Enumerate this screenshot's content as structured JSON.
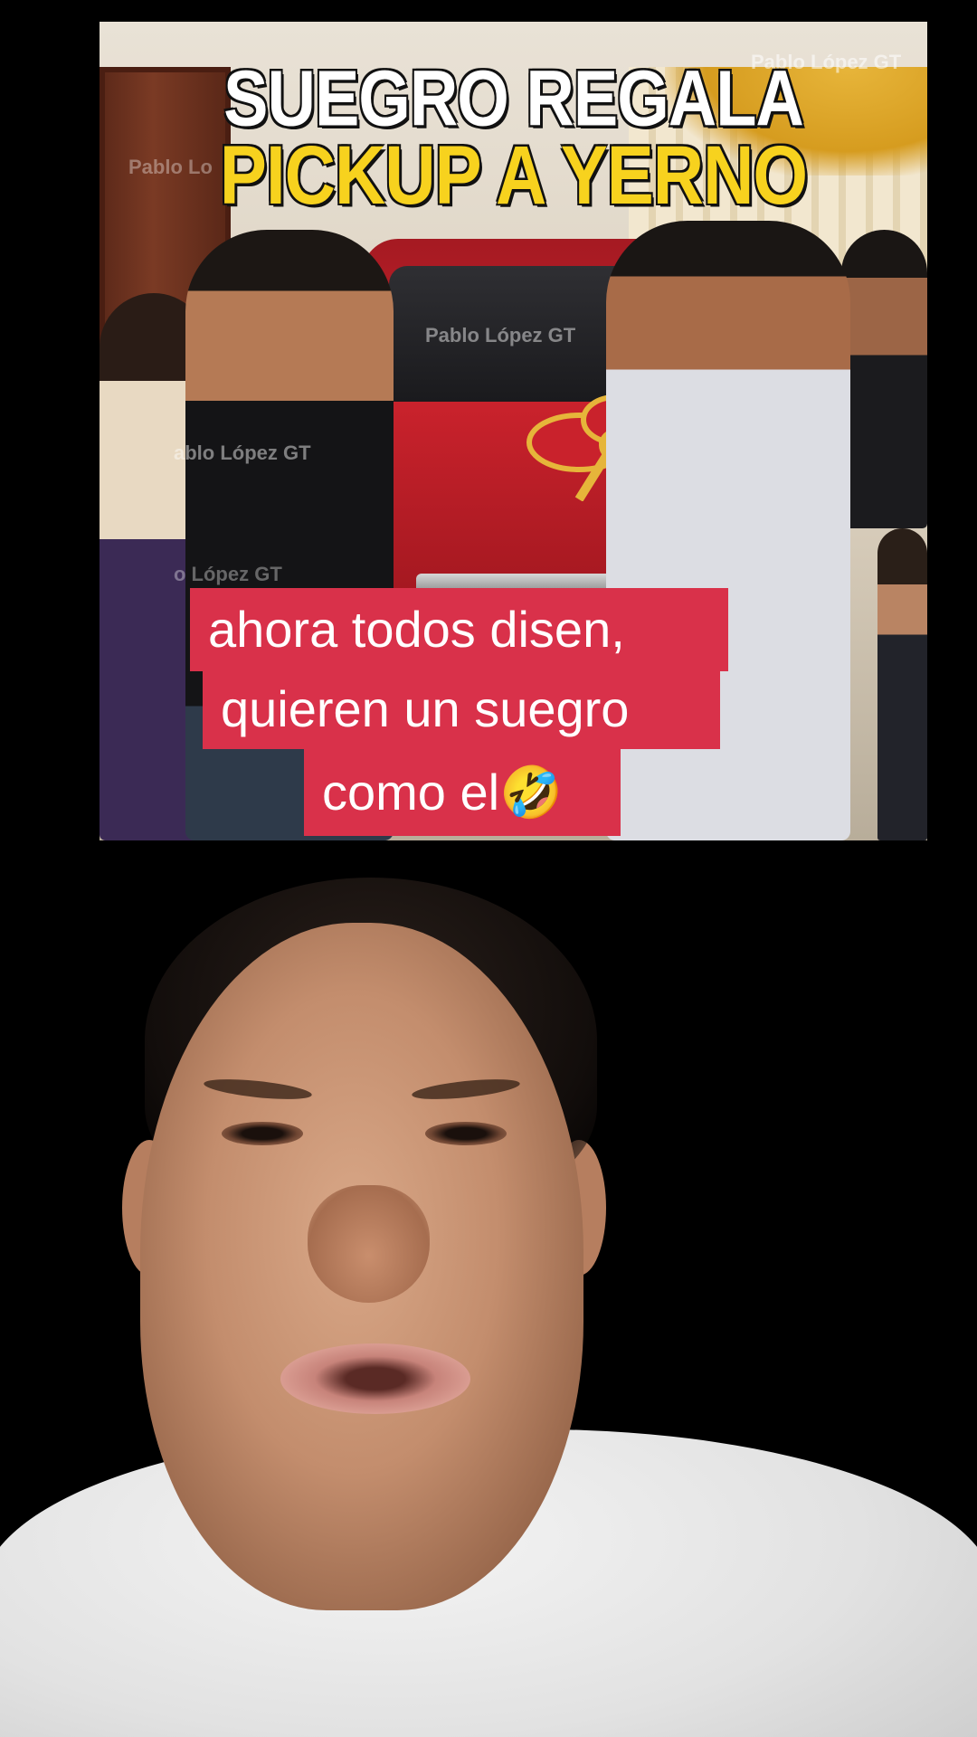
{
  "news_image": {
    "headline_line1": "SUEGRO REGALA",
    "headline_line2": "PICKUP A YERNO",
    "headline_colors": {
      "line1": "#ffffff",
      "line2": "#f7d21e"
    },
    "watermark": "Pablo López GT",
    "watermark_partial_1": "Pablo Lo",
    "watermark_partial_2": "ablo López GT",
    "watermark_partial_3": "o López GT"
  },
  "caption": {
    "line1": "ahora todos disen,",
    "line2": "quieren un suegro",
    "line3": "como el🤣",
    "background_color": "#d9314a"
  }
}
